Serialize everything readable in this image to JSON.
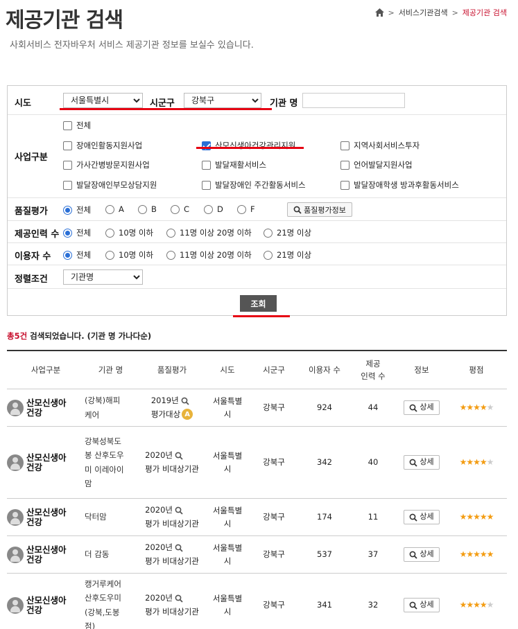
{
  "header": {
    "title": "제공기관 검색",
    "subtitle": "사회서비스 전자바우처 서비스 제공기관 정보를 보실수 있습니다.",
    "breadcrumb": [
      "서비스기관검색",
      "제공기관 검색"
    ]
  },
  "filters": {
    "sido_label": "시도",
    "sido_value": "서울특별시",
    "sigungu_label": "시군구",
    "sigungu_value": "강북구",
    "agency_label": "기관 명",
    "agency_placeholder": "",
    "business_label": "사업구분",
    "business_all": "전체",
    "business_items": [
      {
        "label": "장애인활동지원사업",
        "checked": false
      },
      {
        "label": "산모신생아건강관리지원",
        "checked": true
      },
      {
        "label": "지역사회서비스투자",
        "checked": false
      },
      {
        "label": "가사간병방문지원사업",
        "checked": false
      },
      {
        "label": "발달재활서비스",
        "checked": false
      },
      {
        "label": "언어발달지원사업",
        "checked": false
      },
      {
        "label": "발달장애인부모상담지원",
        "checked": false
      },
      {
        "label": "발달장애인 주간활동서비스",
        "checked": false
      },
      {
        "label": "발달장애학생 방과후활동서비스",
        "checked": false
      }
    ],
    "quality_label": "품질평가",
    "quality_options": [
      "전체",
      "A",
      "B",
      "C",
      "D",
      "F"
    ],
    "quality_button": "품질평가정보",
    "staff_label": "제공인력 수",
    "staff_options": [
      "전체",
      "10명 이하",
      "11명 이상 20명 이하",
      "21명 이상"
    ],
    "users_label": "이용자 수",
    "users_options": [
      "전체",
      "10명 이하",
      "11명 이상 20명 이하",
      "21명 이상"
    ],
    "sort_label": "정렬조건",
    "sort_value": "기관명",
    "search_button": "조회"
  },
  "result": {
    "count": "총5건",
    "text": " 검색되었습니다. (기관 명 가나다순)"
  },
  "table": {
    "headers": [
      "사업구분",
      "기관 명",
      "품질평가",
      "시도",
      "시군구",
      "이용자 수",
      "제공\n인력 수",
      "정보",
      "평점"
    ],
    "detail_label": "상세",
    "rows": [
      {
        "business": "산모신생아\n건강",
        "agency": "(강북)해피\n케어",
        "year": "2019년",
        "eval": "평가대상",
        "grade": "A",
        "sido": "서울특별\n시",
        "sigungu": "강북구",
        "users": "924",
        "staff": "44",
        "rating": 4.5
      },
      {
        "business": "산모신생아\n건강",
        "agency": "강북성북도\n봉 산후도우\n미 이레아이\n맘",
        "year": "2020년",
        "eval": "평가 비대상기관",
        "grade": "",
        "sido": "서울특별\n시",
        "sigungu": "강북구",
        "users": "342",
        "staff": "40",
        "rating": 4.5
      },
      {
        "business": "산모신생아\n건강",
        "agency": "닥터맘",
        "year": "2020년",
        "eval": "평가 비대상기관",
        "grade": "",
        "sido": "서울특별\n시",
        "sigungu": "강북구",
        "users": "174",
        "staff": "11",
        "rating": 5
      },
      {
        "business": "산모신생아\n건강",
        "agency": "더 감동",
        "year": "2020년",
        "eval": "평가 비대상기관",
        "grade": "",
        "sido": "서울특별\n시",
        "sigungu": "강북구",
        "users": "537",
        "staff": "37",
        "rating": 5
      },
      {
        "business": "산모신생아\n건강",
        "agency": "캥거루케어\n산후도우미\n(강북,도봉\n점)",
        "year": "2020년",
        "eval": "평가 비대상기관",
        "grade": "",
        "sido": "서울특별\n시",
        "sigungu": "강북구",
        "users": "341",
        "staff": "32",
        "rating": 4.5
      }
    ]
  },
  "colors": {
    "accent": "#c8102e",
    "highlight": "#e60012",
    "checked": "#2a6fd6",
    "star": "#f39c12"
  }
}
